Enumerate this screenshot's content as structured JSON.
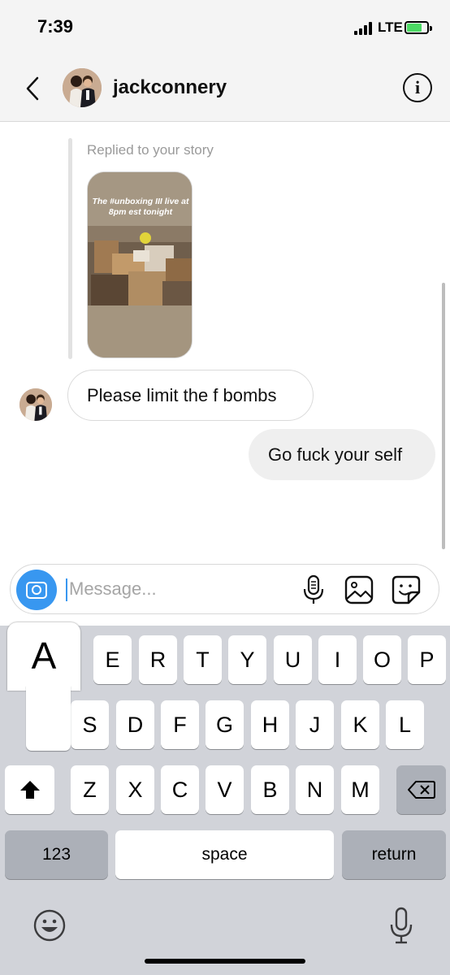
{
  "status_bar": {
    "time": "7:39",
    "network": "LTE"
  },
  "header": {
    "username": "jackconnery",
    "info_glyph": "i"
  },
  "chat": {
    "replied_label": "Replied to your story",
    "story_text": "The #unboxing III live at 8pm est tonight",
    "incoming_message": "Please limit the f bombs",
    "outgoing_message": "Go fuck your self"
  },
  "composer": {
    "placeholder": "Message..."
  },
  "keyboard": {
    "popup_key": "A",
    "row1": [
      "E",
      "R",
      "T",
      "Y",
      "U",
      "I",
      "O",
      "P"
    ],
    "row2": [
      "S",
      "D",
      "F",
      "G",
      "H",
      "J",
      "K",
      "L"
    ],
    "row3": [
      "Z",
      "X",
      "C",
      "V",
      "B",
      "N",
      "M"
    ],
    "numbers_label": "123",
    "space_label": "space",
    "return_label": "return"
  },
  "colors": {
    "accent": "#3897f0",
    "battery": "#4cd964"
  },
  "icons": [
    "back-icon",
    "info-icon",
    "camera-icon",
    "mic-icon",
    "image-icon",
    "sticker-icon",
    "shift-icon",
    "delete-icon",
    "emoji-icon"
  ]
}
